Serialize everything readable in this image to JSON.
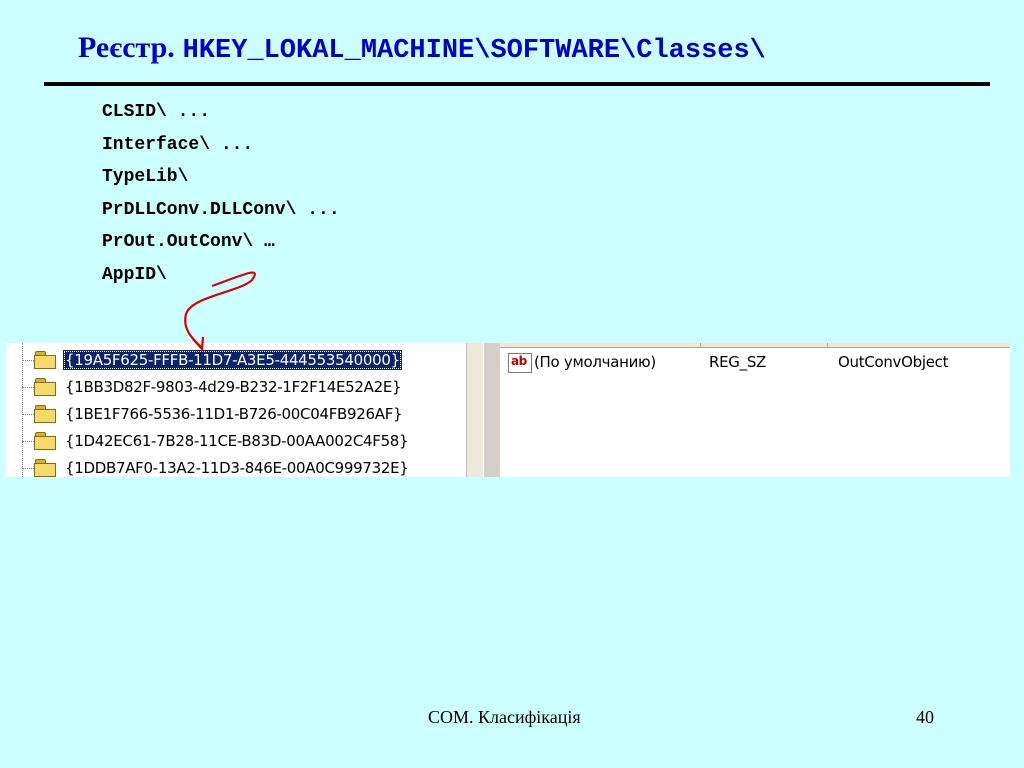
{
  "title": {
    "prefix": "Реєстр.",
    "path": "HKEY_LOKAL_MACHINE\\SOFTWARE\\Classes\\"
  },
  "subkeys": [
    "CLSID\\ ...",
    "Interface\\ ...",
    "TypeLib\\",
    "PrDLLConv.DLLConv\\ ...",
    "PrOut.OutConv\\ …",
    "AppID\\"
  ],
  "registry": {
    "tree_items": [
      {
        "label": "{19A5F625-FFFB-11D7-A3E5-444553540000}",
        "selected": true
      },
      {
        "label": "{1BB3D82F-9803-4d29-B232-1F2F14E52A2E}",
        "selected": false
      },
      {
        "label": "{1BE1F766-5536-11D1-B726-00C04FB926AF}",
        "selected": false
      },
      {
        "label": "{1D42EC61-7B28-11CE-B83D-00AA002C4F58}",
        "selected": false
      },
      {
        "label": "{1DDB7AF0-13A2-11D3-846E-00A0C999732E}",
        "selected": false
      }
    ],
    "value_row": {
      "icon": "ab-string-icon",
      "name": "(По умолчанию)",
      "type": "REG_SZ",
      "data": "OutConvObject"
    }
  },
  "colors": {
    "background": "#ccffff",
    "title": "#0000cc",
    "arrow": "#dd0000",
    "selection": "#0a246a"
  },
  "footer": {
    "text": "COM. Класифікація",
    "page": "40"
  }
}
